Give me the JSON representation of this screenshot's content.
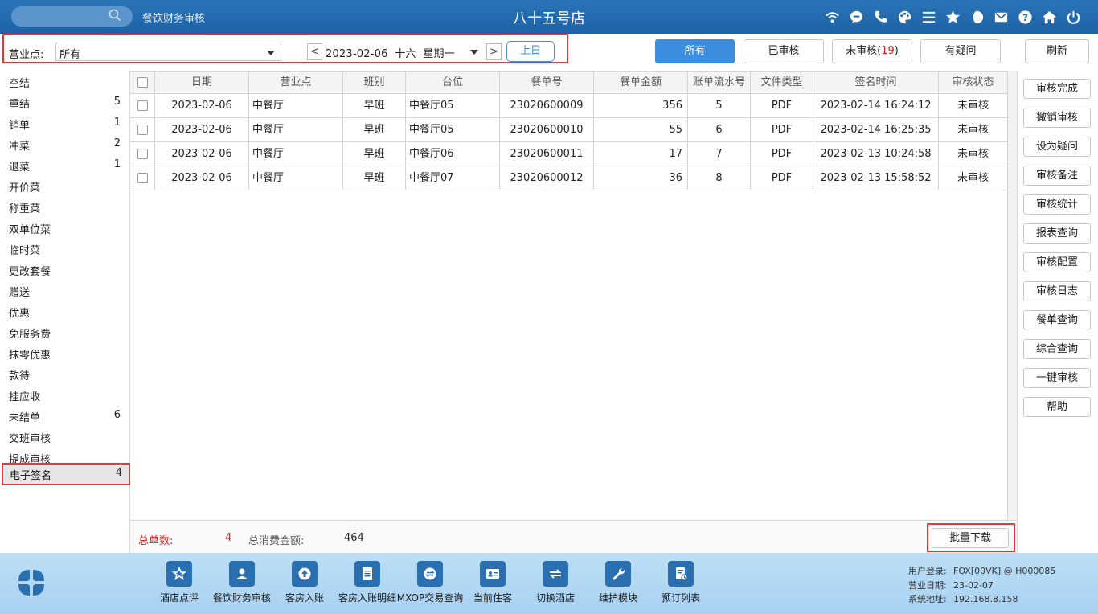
{
  "topbar": {
    "app_title": "餐饮财务审核",
    "store_name": "八十五号店",
    "icons": [
      "wifi-icon",
      "chat-icon",
      "phone-icon",
      "palette-icon",
      "menu-icon",
      "star-icon",
      "moon-icon",
      "mail-icon",
      "help-icon",
      "home-icon",
      "power-icon"
    ]
  },
  "filter": {
    "biz_label": "营业点:",
    "biz_value": "所有",
    "date_value": "2023-02-06  十六  星期一",
    "prev_day": "上日",
    "prev_arrow": "<",
    "next_arrow": ">"
  },
  "status_buttons": {
    "all": "所有",
    "audited": "已审核",
    "unaudited": "未审核(",
    "unaudited_count": "19",
    "unaudited_close": ")",
    "doubtful": "有疑问",
    "refresh": "刷新"
  },
  "sidebar": {
    "items": [
      {
        "label": "空结",
        "count": ""
      },
      {
        "label": "重结",
        "count": "5"
      },
      {
        "label": "销单",
        "count": "1"
      },
      {
        "label": "冲菜",
        "count": "2"
      },
      {
        "label": "退菜",
        "count": "1"
      },
      {
        "label": "开价菜",
        "count": ""
      },
      {
        "label": "称重菜",
        "count": ""
      },
      {
        "label": "双单位菜",
        "count": ""
      },
      {
        "label": "临时菜",
        "count": ""
      },
      {
        "label": "更改套餐",
        "count": ""
      },
      {
        "label": "赠送",
        "count": ""
      },
      {
        "label": "优惠",
        "count": ""
      },
      {
        "label": "免服务费",
        "count": ""
      },
      {
        "label": "抹零优惠",
        "count": ""
      },
      {
        "label": "款待",
        "count": ""
      },
      {
        "label": "挂应收",
        "count": ""
      },
      {
        "label": "未结单",
        "count": "6"
      },
      {
        "label": "交班审核",
        "count": ""
      },
      {
        "label": "提成审核",
        "count": ""
      },
      {
        "label": "电子签名",
        "count": "4"
      }
    ]
  },
  "table": {
    "headers": [
      "日期",
      "营业点",
      "班别",
      "台位",
      "餐单号",
      "餐单金额",
      "账单流水号",
      "文件类型",
      "签名时间",
      "审核状态"
    ],
    "rows": [
      [
        "2023-02-06",
        "中餐厅",
        "早班",
        "中餐厅05",
        "23020600009",
        "356",
        "5",
        "PDF",
        "2023-02-14 16:24:12",
        "未审核"
      ],
      [
        "2023-02-06",
        "中餐厅",
        "早班",
        "中餐厅05",
        "23020600010",
        "55",
        "6",
        "PDF",
        "2023-02-14 16:25:35",
        "未审核"
      ],
      [
        "2023-02-06",
        "中餐厅",
        "早班",
        "中餐厅06",
        "23020600011",
        "17",
        "7",
        "PDF",
        "2023-02-13 10:24:58",
        "未审核"
      ],
      [
        "2023-02-06",
        "中餐厅",
        "早班",
        "中餐厅07",
        "23020600012",
        "36",
        "8",
        "PDF",
        "2023-02-13 15:58:52",
        "未审核"
      ]
    ]
  },
  "totals": {
    "count_label": "总单数:",
    "count_value": "4",
    "amount_label": "总消费金额:",
    "amount_value": "464",
    "batch_download": "批量下载"
  },
  "right_actions": [
    "审核完成",
    "撤销审核",
    "设为疑问",
    "审核备注",
    "审核统计",
    "报表查询",
    "审核配置",
    "审核日志",
    "餐单查询",
    "综合查询",
    "一键审核",
    "帮助"
  ],
  "dock": [
    {
      "label": "酒店点评",
      "icon": "review-icon"
    },
    {
      "label": "餐饮财务审核",
      "icon": "user-icon"
    },
    {
      "label": "客房入账",
      "icon": "upload-icon"
    },
    {
      "label": "客房入账明细",
      "icon": "document-icon"
    },
    {
      "label": "MXOP交易查询",
      "icon": "exchange-icon"
    },
    {
      "label": "当前住客",
      "icon": "id-card-icon"
    },
    {
      "label": "切换酒店",
      "icon": "switch-icon"
    },
    {
      "label": "维护模块",
      "icon": "wrench-icon"
    },
    {
      "label": "预订列表",
      "icon": "booking-icon"
    }
  ],
  "sysinfo": {
    "user_label": "用户登录:",
    "user_value": "FOX[00VK] @ H000085",
    "bizdate_label": "营业日期:",
    "bizdate_value": "23-02-07",
    "addr_label": "系统地址:",
    "addr_value": "192.168.8.158"
  },
  "colors": {
    "topbar": "#1d63a6",
    "accent": "#3d8ede",
    "highlight_red": "#e23a3a",
    "bottombar": "#bcdff7"
  }
}
